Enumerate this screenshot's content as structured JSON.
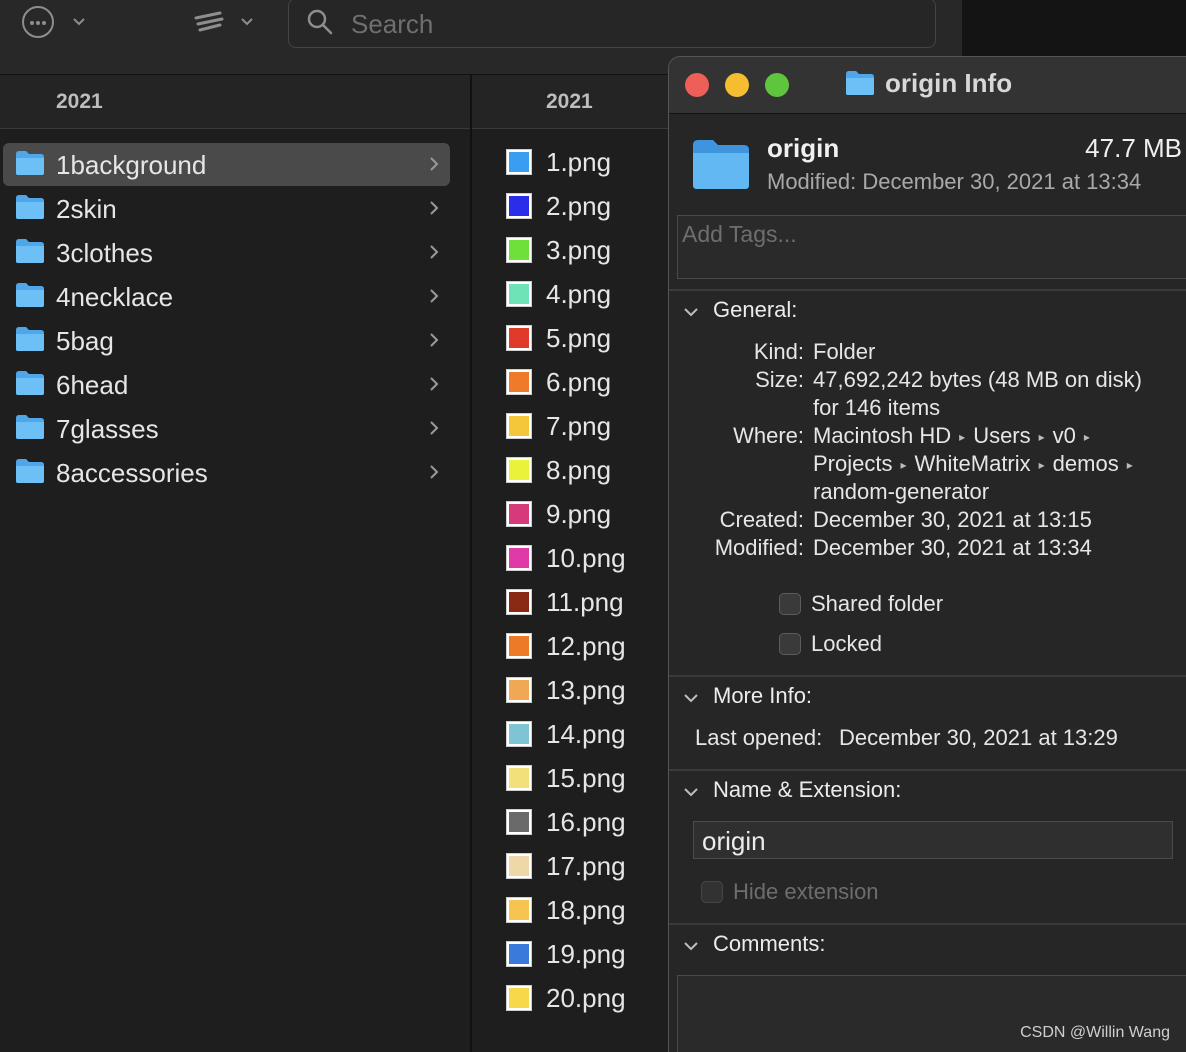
{
  "toolbar": {
    "search_placeholder": "Search"
  },
  "column1": {
    "header": "2021",
    "items": [
      {
        "label": "1background",
        "selected": true
      },
      {
        "label": "2skin"
      },
      {
        "label": "3clothes"
      },
      {
        "label": "4necklace"
      },
      {
        "label": "5bag"
      },
      {
        "label": "6head"
      },
      {
        "label": "7glasses"
      },
      {
        "label": "8accessories"
      }
    ]
  },
  "column2": {
    "header": "2021",
    "files": [
      {
        "label": "1.png",
        "color": "#3a9ef0"
      },
      {
        "label": "2.png",
        "color": "#2a2ee8"
      },
      {
        "label": "3.png",
        "color": "#6fe03a"
      },
      {
        "label": "4.png",
        "color": "#6fe3b8"
      },
      {
        "label": "5.png",
        "color": "#e03a2a"
      },
      {
        "label": "6.png",
        "color": "#ee7a2a"
      },
      {
        "label": "7.png",
        "color": "#f4c63a"
      },
      {
        "label": "8.png",
        "color": "#eaf23a"
      },
      {
        "label": "9.png",
        "color": "#d63a7a"
      },
      {
        "label": "10.png",
        "color": "#e03aa8"
      },
      {
        "label": "11.png",
        "color": "#8a2a14"
      },
      {
        "label": "12.png",
        "color": "#ec7a26"
      },
      {
        "label": "13.png",
        "color": "#f0a854"
      },
      {
        "label": "14.png",
        "color": "#7ec4d4"
      },
      {
        "label": "15.png",
        "color": "#f2e07a"
      },
      {
        "label": "16.png",
        "color": "#6a6a6a"
      },
      {
        "label": "17.png",
        "color": "#efd8a8"
      },
      {
        "label": "18.png",
        "color": "#f6c450"
      },
      {
        "label": "19.png",
        "color": "#3a7ad8"
      },
      {
        "label": "20.png",
        "color": "#f6d84a"
      }
    ]
  },
  "info": {
    "title": "origin Info",
    "name": "origin",
    "size": "47.7 MB",
    "modified_line": "Modified: December 30, 2021 at 13:34",
    "tags_placeholder": "Add Tags...",
    "general": {
      "heading": "General:",
      "kind_label": "Kind:",
      "kind": "Folder",
      "size_label": "Size:",
      "size_line1": "47,692,242 bytes (48 MB on disk)",
      "size_line2": "for 146 items",
      "where_label": "Where:",
      "path": [
        "Macintosh HD",
        "Users",
        "v0",
        "Projects",
        "WhiteMatrix",
        "demos",
        "random-generator"
      ],
      "created_label": "Created:",
      "created": "December 30, 2021 at 13:15",
      "modified_label": "Modified:",
      "modified": "December 30, 2021 at 13:34",
      "shared_label": "Shared folder",
      "locked_label": "Locked"
    },
    "more_info": {
      "heading": "More Info:",
      "last_opened_label": "Last opened:",
      "last_opened": "December 30, 2021 at 13:29"
    },
    "name_ext": {
      "heading": "Name & Extension:",
      "value": "origin",
      "hide_label": "Hide extension"
    },
    "comments": {
      "heading": "Comments:"
    }
  },
  "watermark": "CSDN @Willin Wang",
  "colors": {
    "close": "#ed5f57",
    "minimize": "#f5bd2f",
    "zoom": "#5fc53f",
    "folder": "#5cb3f0"
  }
}
